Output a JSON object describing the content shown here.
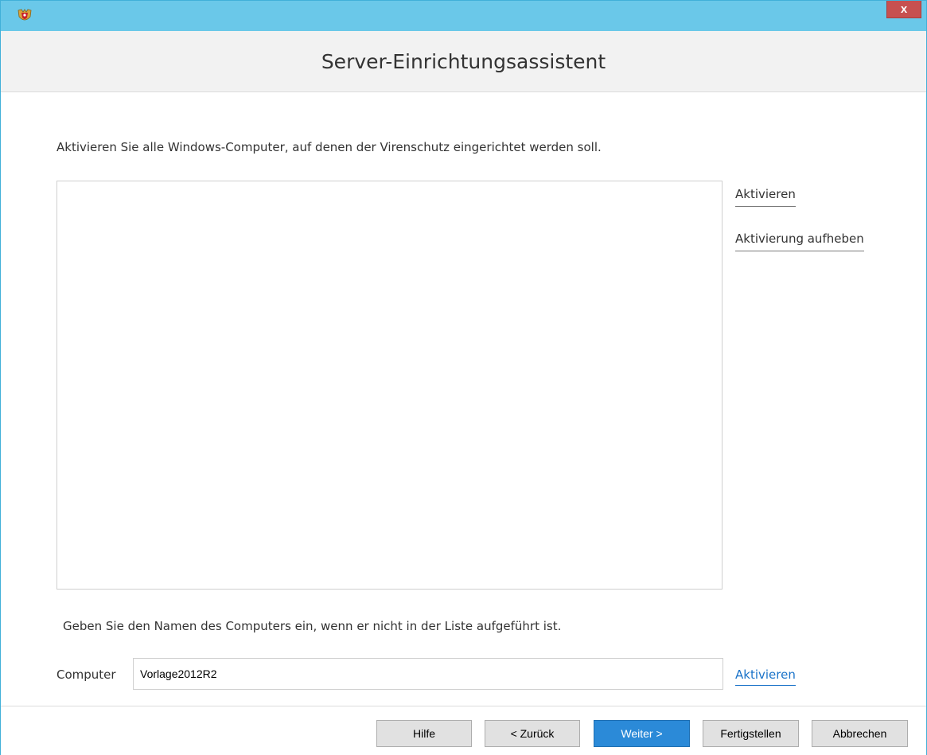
{
  "window": {
    "title": "Server-Einrichtungsassistent",
    "close_label": "x",
    "icon": "shield-icon"
  },
  "main": {
    "instruction": "Aktivieren Sie alle Windows-Computer, auf denen der Virenschutz eingerichtet werden soll.",
    "list_items": [],
    "side_links": {
      "activate": "Aktivieren",
      "deactivate": "Aktivierung aufheben"
    },
    "hint": "Geben Sie den Namen des Computers ein, wenn er nicht in der Liste aufgeführt ist.",
    "computer_label": "Computer",
    "computer_value": "Vorlage2012R2",
    "activate_link": "Aktivieren"
  },
  "footer": {
    "help": "Hilfe",
    "back": "< Zurück",
    "next": "Weiter >",
    "finish": "Fertigstellen",
    "cancel": "Abbrechen"
  },
  "colors": {
    "titlebar": "#6ac8e9",
    "close": "#c75050",
    "primary_button": "#2b8ad8",
    "link_blue": "#1a73c9"
  }
}
